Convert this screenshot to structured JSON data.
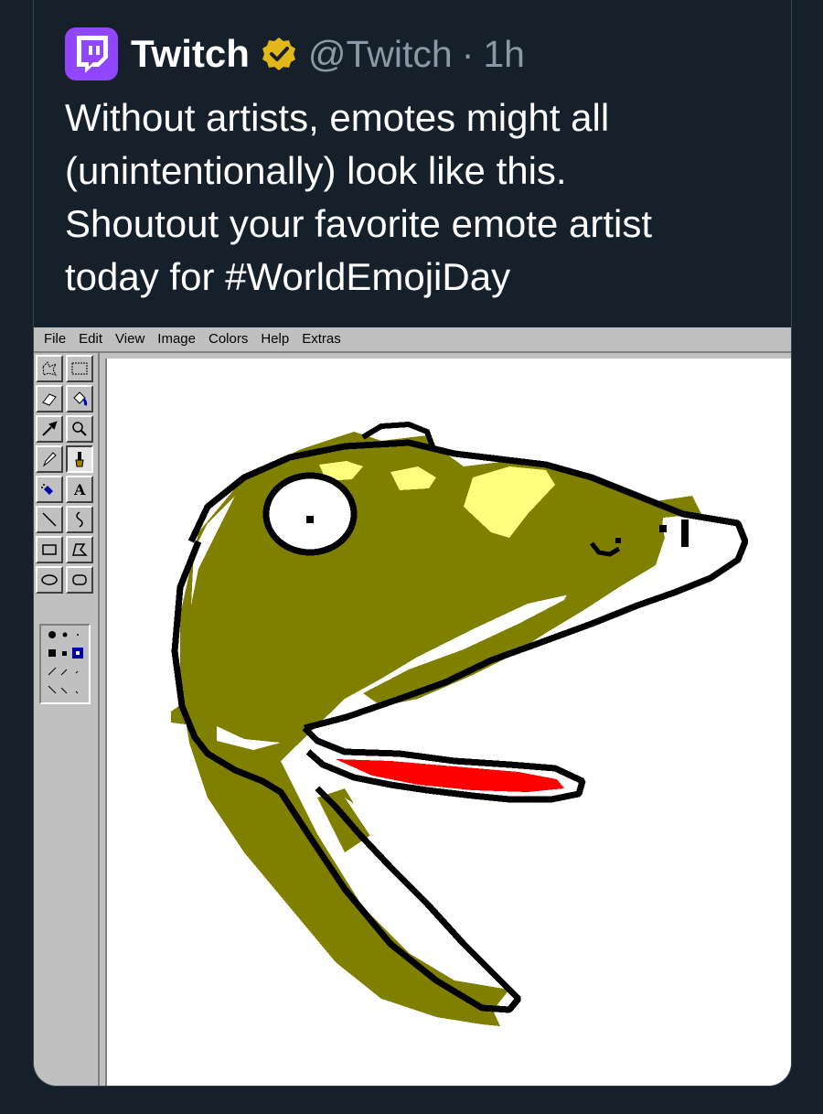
{
  "tweet": {
    "author_name": "Twitch",
    "handle": "@Twitch",
    "separator": "·",
    "time": "1h",
    "text": "Without artists, emotes might all\n(unintentionally) look like this.\nShoutout your favorite emote artist\ntoday for #WorldEmojiDay",
    "brand_color": "#9146ff",
    "verified_badge": "gold-verified-badge-icon"
  },
  "paint": {
    "menu": [
      "File",
      "Edit",
      "View",
      "Image",
      "Colors",
      "Help",
      "Extras"
    ],
    "tools": [
      "free-select-icon",
      "rect-select-icon",
      "eraser-icon",
      "fill-icon",
      "color-picker-icon",
      "magnifier-icon",
      "pencil-icon",
      "brush-icon",
      "airbrush-icon",
      "text-icon",
      "line-icon",
      "curve-icon",
      "rectangle-icon",
      "polygon-icon",
      "ellipse-icon",
      "rounded-rect-icon"
    ],
    "colors": {
      "olive": "#808000",
      "highlight": "#ffff80",
      "tongue": "#ff0000",
      "outline": "#000000",
      "canvas": "#ffffff",
      "chrome": "#c0c0c0"
    }
  }
}
